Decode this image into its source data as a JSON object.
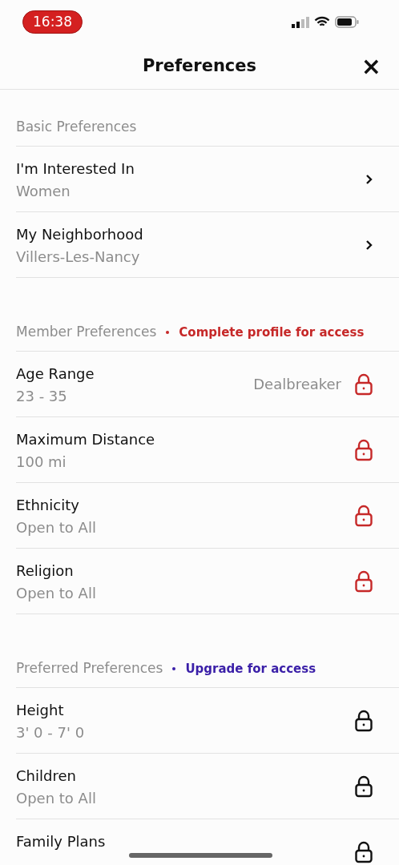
{
  "status_bar": {
    "time": "16:38"
  },
  "header": {
    "title": "Preferences",
    "close": "×"
  },
  "sections": [
    {
      "title": "Basic Preferences",
      "rows": [
        {
          "label": "I'm Interested In",
          "value": "Women",
          "kind": "chevron"
        },
        {
          "label": "My Neighborhood",
          "value": "Villers-Les-Nancy",
          "kind": "chevron"
        }
      ]
    },
    {
      "title": "Member Preferences",
      "note": "Complete profile for access",
      "color": "#c62828",
      "rows": [
        {
          "label": "Age Range",
          "value": "23 - 35",
          "tag": "Dealbreaker",
          "kind": "lock_profile"
        },
        {
          "label": "Maximum Distance",
          "value": "100 mi",
          "kind": "lock_profile"
        },
        {
          "label": "Ethnicity",
          "value": "Open to All",
          "kind": "lock_profile"
        },
        {
          "label": "Religion",
          "value": "Open to All",
          "kind": "lock_profile"
        }
      ]
    },
    {
      "title": "Preferred Preferences",
      "note": "Upgrade for access",
      "color": "#3a1fa8",
      "rows": [
        {
          "label": "Height",
          "value": "3' 0 - 7' 0",
          "kind": "lock_upgrade"
        },
        {
          "label": "Children",
          "value": "Open to All",
          "kind": "lock_upgrade"
        },
        {
          "label": "Family Plans",
          "kind": "lock_upgrade"
        }
      ]
    }
  ]
}
